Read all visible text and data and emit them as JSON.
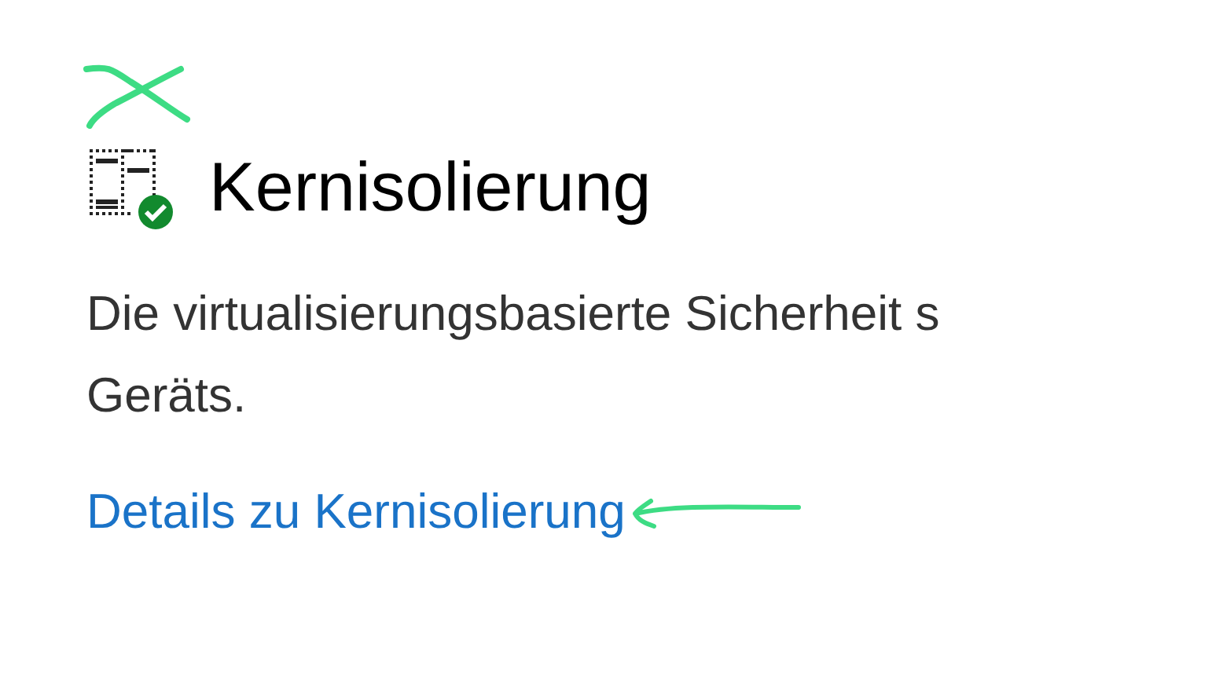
{
  "section": {
    "title": "Kernisolierung",
    "description_lines": [
      "Die virtualisierungsbasierte Sicherheit s",
      "Geräts."
    ],
    "link": "Details zu Kernisolierung"
  }
}
